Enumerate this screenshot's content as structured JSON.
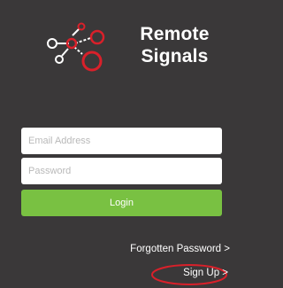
{
  "brand": {
    "line1": "Remote",
    "line2": "Signals",
    "logo_icon": "signal-nodes-logo"
  },
  "form": {
    "email_placeholder": "Email Address",
    "email_value": "",
    "password_placeholder": "Password",
    "password_value": "",
    "login_label": "Login"
  },
  "links": {
    "forgot_password": "Forgotten Password >",
    "sign_up": "Sign Up >"
  },
  "colors": {
    "background": "#3a3839",
    "login_button": "#79c142",
    "logo_accent": "#d9202a",
    "highlight_ring": "#d9202a"
  }
}
